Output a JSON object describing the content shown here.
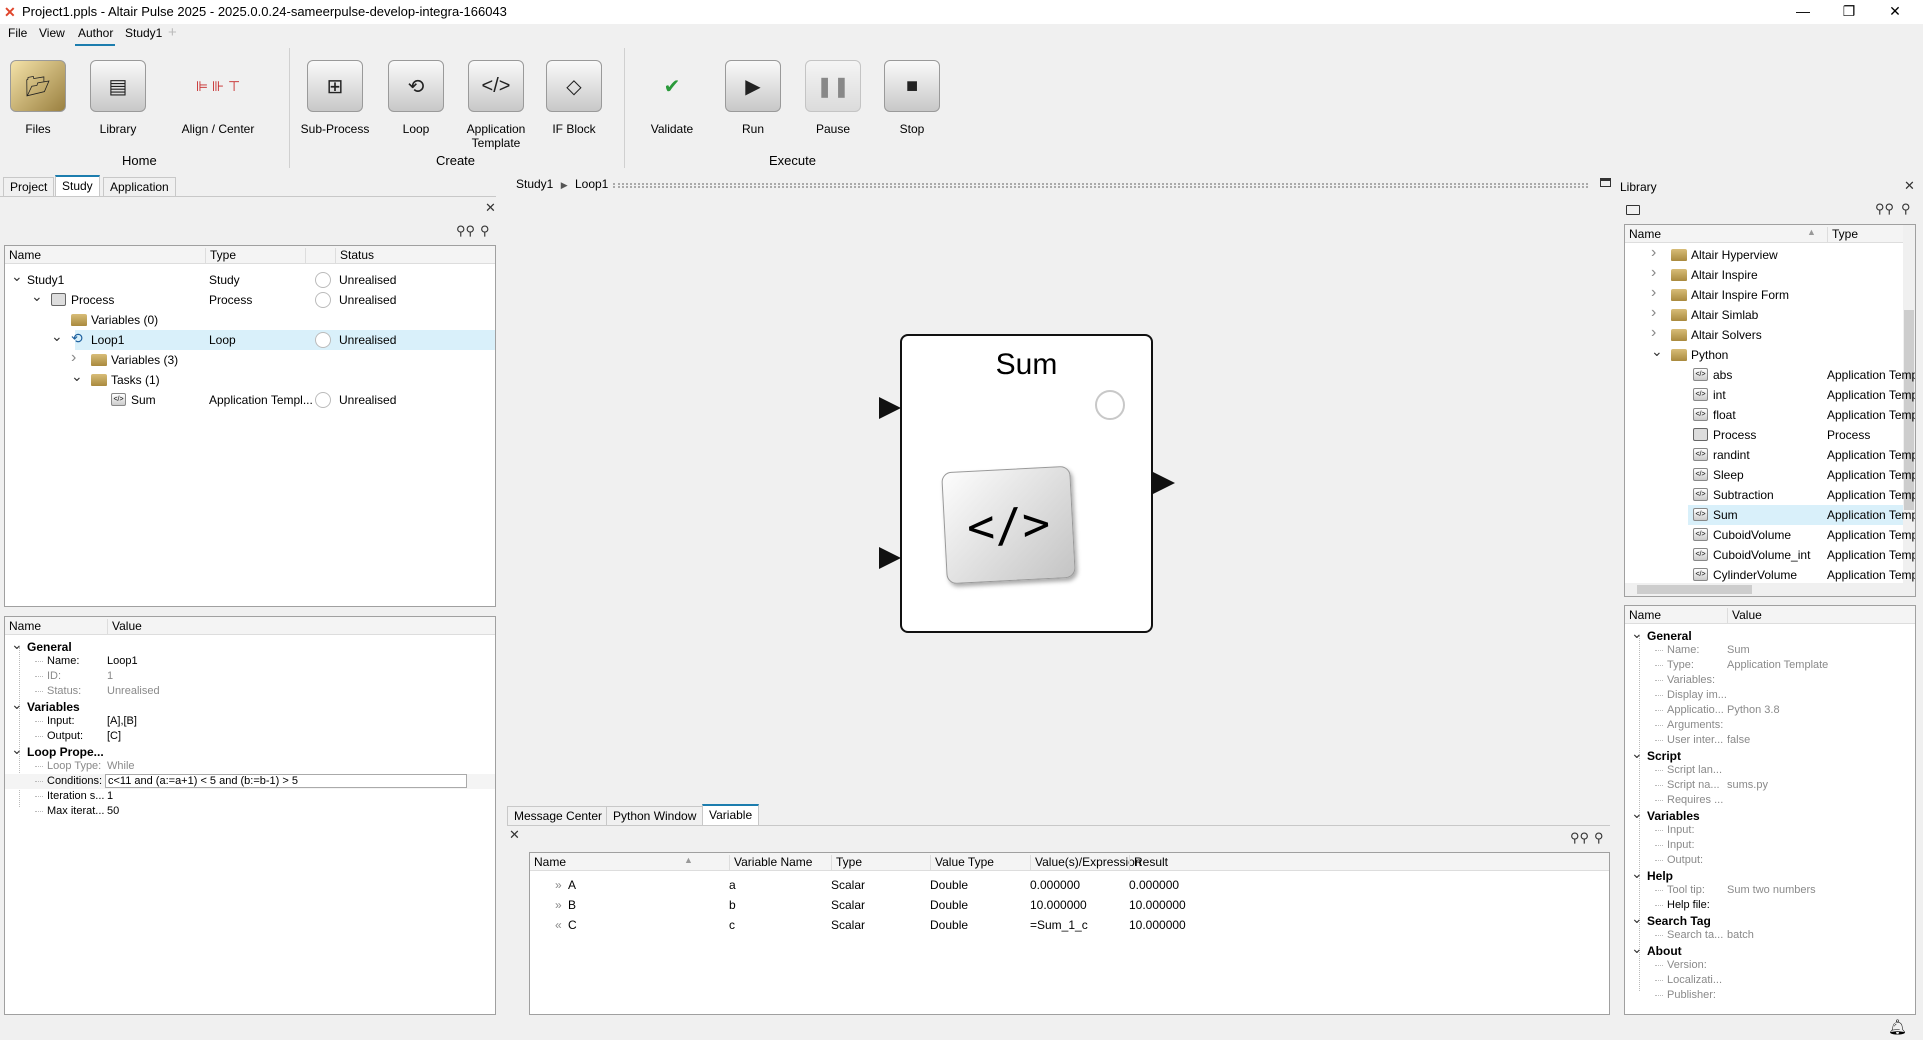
{
  "window": {
    "title": "Project1.ppls - Altair Pulse 2025 - 2025.0.0.24-sameerpulse-develop-integra-166043",
    "minimize": "—",
    "restore": "❐",
    "close": "✕"
  },
  "menu": {
    "items": [
      "File",
      "View",
      "Author",
      "Study1"
    ],
    "add": "+"
  },
  "ribbon": {
    "buttons": [
      {
        "label": "Files",
        "icon": "files-icon"
      },
      {
        "label": "Library",
        "icon": "library-icon"
      },
      {
        "label": "Align / Center",
        "icon": "align-icon"
      },
      {
        "label": "Sub-Process",
        "icon": "subprocess-icon"
      },
      {
        "label": "Loop",
        "icon": "loop-icon"
      },
      {
        "label": "Application Template",
        "icon": "code-icon"
      },
      {
        "label": "IF Block",
        "icon": "if-block-icon"
      },
      {
        "label": "Validate",
        "icon": "validate-icon"
      },
      {
        "label": "Run",
        "icon": "play-icon"
      },
      {
        "label": "Pause",
        "icon": "pause-icon"
      },
      {
        "label": "Stop",
        "icon": "stop-icon"
      }
    ],
    "groups": [
      "Home",
      "Create",
      "Execute"
    ]
  },
  "left_tabs": [
    "Project",
    "Study",
    "Application"
  ],
  "study_tree": {
    "columns": [
      "Name",
      "Type",
      "",
      "Status"
    ],
    "rows": [
      {
        "name": "Study1",
        "type": "Study",
        "status": "Unrealised",
        "level": 0,
        "exp": "open",
        "icon": "none"
      },
      {
        "name": "Process",
        "type": "Process",
        "status": "Unrealised",
        "level": 1,
        "exp": "open",
        "icon": "process"
      },
      {
        "name": "Variables (0)",
        "type": "",
        "status": "",
        "level": 2,
        "exp": "none",
        "icon": "folder"
      },
      {
        "name": "Loop1",
        "type": "Loop",
        "status": "Unrealised",
        "level": 2,
        "exp": "open",
        "icon": "loop",
        "selected": true
      },
      {
        "name": "Variables (3)",
        "type": "",
        "status": "",
        "level": 3,
        "exp": "closed",
        "icon": "folder"
      },
      {
        "name": "Tasks (1)",
        "type": "",
        "status": "",
        "level": 3,
        "exp": "open",
        "icon": "folder"
      },
      {
        "name": "Sum",
        "type": "Application Templ...",
        "status": "Unrealised",
        "level": 4,
        "exp": "none",
        "icon": "template"
      }
    ]
  },
  "loop_props": {
    "columns": [
      "Name",
      "Value"
    ],
    "rows": [
      {
        "section": "General"
      },
      {
        "label": "Name:",
        "value": "Loop1"
      },
      {
        "label": "ID:",
        "value": "1",
        "dim": true
      },
      {
        "label": "Status:",
        "value": "Unrealised",
        "dim": true
      },
      {
        "section": "Variables"
      },
      {
        "label": "Input:",
        "value": "[A],[B]"
      },
      {
        "label": "Output:",
        "value": "[C]"
      },
      {
        "section": "Loop Prope..."
      },
      {
        "label": "Loop Type:",
        "value": "While",
        "dim": true
      },
      {
        "label": "Conditions:",
        "value": "c<11 and (a:=a+1) < 5  and (b:=b-1) > 5",
        "edit": true
      },
      {
        "label": "Iteration s...",
        "value": "1"
      },
      {
        "label": "Max iterat...",
        "value": "50"
      }
    ]
  },
  "canvas": {
    "breadcrumb": [
      "Study1",
      "Loop1"
    ],
    "node": {
      "title": "Sum",
      "glyph": "</>"
    }
  },
  "bottom_tabs": [
    "Message Center",
    "Python Window",
    "Variable"
  ],
  "variables": {
    "columns": [
      "Name",
      "Variable Name",
      "Type",
      "Value Type",
      "Value(s)/Expression",
      "Result"
    ],
    "rows": [
      {
        "dir": "»",
        "name": "A",
        "var": "a",
        "type": "Scalar",
        "vtype": "Double",
        "value": "0.000000",
        "result": "0.000000"
      },
      {
        "dir": "»",
        "name": "B",
        "var": "b",
        "type": "Scalar",
        "vtype": "Double",
        "value": "10.000000",
        "result": "10.000000"
      },
      {
        "dir": "«",
        "name": "C",
        "var": "c",
        "type": "Scalar",
        "vtype": "Double",
        "value": "=Sum_1_c",
        "result": "10.000000"
      }
    ]
  },
  "library": {
    "title": "Library",
    "columns": [
      "Name",
      "Type"
    ],
    "rows": [
      {
        "name": "Altair Hyperview",
        "type": "",
        "kind": "folder",
        "exp": "closed"
      },
      {
        "name": "Altair Inspire",
        "type": "",
        "kind": "folder",
        "exp": "closed"
      },
      {
        "name": "Altair Inspire Form",
        "type": "",
        "kind": "folder",
        "exp": "closed"
      },
      {
        "name": "Altair Simlab",
        "type": "",
        "kind": "folder",
        "exp": "closed"
      },
      {
        "name": "Altair Solvers",
        "type": "",
        "kind": "folder",
        "exp": "closed"
      },
      {
        "name": "Python",
        "type": "",
        "kind": "folder",
        "exp": "open"
      },
      {
        "name": "abs",
        "type": "Application Temp",
        "kind": "template"
      },
      {
        "name": "int",
        "type": "Application Temp",
        "kind": "template"
      },
      {
        "name": "float",
        "type": "Application Temp",
        "kind": "template"
      },
      {
        "name": "Process",
        "type": "Process",
        "kind": "process"
      },
      {
        "name": "randint",
        "type": "Application Temp",
        "kind": "template"
      },
      {
        "name": "Sleep",
        "type": "Application Temp",
        "kind": "template"
      },
      {
        "name": "Subtraction",
        "type": "Application Temp",
        "kind": "template"
      },
      {
        "name": "Sum",
        "type": "Application Temp",
        "kind": "template",
        "selected": true
      },
      {
        "name": "CuboidVolume",
        "type": "Application Temp",
        "kind": "template"
      },
      {
        "name": "CuboidVolume_int",
        "type": "Application Temp",
        "kind": "template"
      },
      {
        "name": "CylinderVolume",
        "type": "Application Temp",
        "kind": "template"
      }
    ]
  },
  "lib_props": {
    "columns": [
      "Name",
      "Value"
    ],
    "rows": [
      {
        "section": "General"
      },
      {
        "label": "Name:",
        "value": "Sum"
      },
      {
        "label": "Type:",
        "value": "Application Template"
      },
      {
        "label": "Variables:",
        "value": ""
      },
      {
        "label": "Display im...",
        "value": ""
      },
      {
        "label": "Applicatio...",
        "value": "Python 3.8"
      },
      {
        "label": "Arguments:",
        "value": ""
      },
      {
        "label": "User inter...",
        "value": "false"
      },
      {
        "section": "Script"
      },
      {
        "label": "Script lan...",
        "value": ""
      },
      {
        "label": "Script na...",
        "value": "sums.py"
      },
      {
        "label": "Requires ...",
        "value": ""
      },
      {
        "section": "Variables"
      },
      {
        "label": "Input:",
        "value": ""
      },
      {
        "label": "Input:",
        "value": ""
      },
      {
        "label": "Output:",
        "value": ""
      },
      {
        "section": "Help"
      },
      {
        "label": "Tool tip:",
        "value": "Sum two numbers"
      },
      {
        "label": "Help file:",
        "value": "",
        "dark": true
      },
      {
        "section": "Search Tag"
      },
      {
        "label": "Search ta...",
        "value": "batch"
      },
      {
        "section": "About"
      },
      {
        "label": "Version:",
        "value": ""
      },
      {
        "label": "Localizati...",
        "value": ""
      },
      {
        "label": "Publisher:",
        "value": ""
      }
    ]
  },
  "colors": {
    "accent": "#1c7dae",
    "selection": "#d9f0fa",
    "folder": "#c9a75a"
  }
}
